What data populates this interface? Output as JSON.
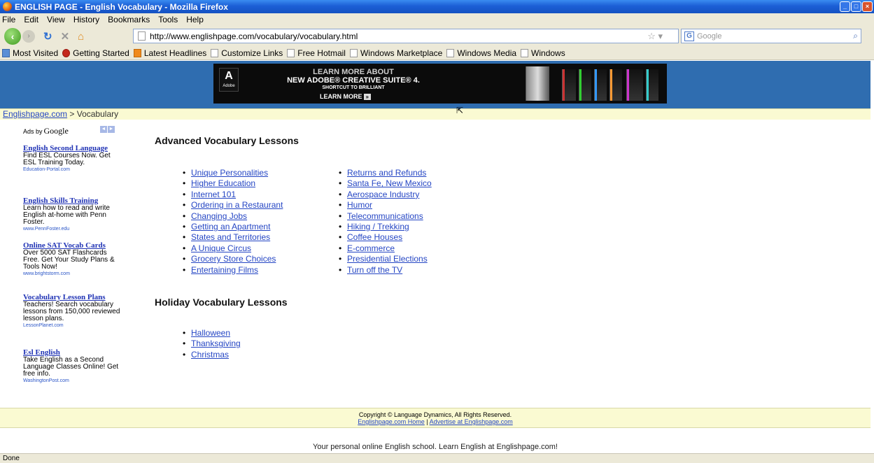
{
  "window": {
    "title": "ENGLISH PAGE - English Vocabulary - Mozilla Firefox"
  },
  "menu": [
    "File",
    "Edit",
    "View",
    "History",
    "Bookmarks",
    "Tools",
    "Help"
  ],
  "nav": {
    "url": "http://www.englishpage.com/vocabulary/vocabulary.html",
    "search_placeholder": "Google"
  },
  "bookmarks": [
    "Most Visited",
    "Getting Started",
    "Latest Headlines",
    "Customize Links",
    "Free Hotmail",
    "Windows Marketplace",
    "Windows Media",
    "Windows"
  ],
  "banner_ad": {
    "line1": "LEARN MORE ABOUT",
    "line2": "NEW ADOBE® CREATIVE SUITE® 4.",
    "line3": "SHORTCUT TO BRILLIANT",
    "button": "LEARN MORE",
    "logo_text": "Adobe"
  },
  "breadcrumb": {
    "home": "Englishpage.com",
    "current": " > Vocabulary"
  },
  "sidebar": {
    "ads_by": "Ads by",
    "google": "Google",
    "ads": [
      {
        "title": "English Second Language",
        "text": "Find ESL Courses Now. Get ESL Training Today.",
        "url": "Education-Portal.com"
      },
      {
        "title": "English Skills Training",
        "text": "Learn how to read and write English at-home with Penn Foster.",
        "url": "www.PennFoster.edu"
      },
      {
        "title": "Online SAT Vocab Cards",
        "text": "Over 5000 SAT Flashcards Free. Get Your Study Plans & Tools Now!",
        "url": "www.brightstorm.com"
      },
      {
        "title": "Vocabulary Lesson Plans",
        "text": "Teachers! Search vocabulary lessons from 150,000 reviewed lesson plans.",
        "url": "LessonPlanet.com"
      },
      {
        "title": "Esl English",
        "text": "Take English as a Second Language Classes Online! Get free info.",
        "url": "WashingtonPost.com"
      }
    ]
  },
  "advanced": {
    "heading": "Advanced Vocabulary Lessons",
    "col1": [
      "Unique Personalities",
      "Higher Education",
      "Internet 101",
      "Ordering in a Restaurant",
      "Changing Jobs",
      "Getting an Apartment",
      "States and Territories",
      "A Unique Circus",
      "Grocery Store Choices",
      "Entertaining Films"
    ],
    "col2": [
      "Returns and Refunds",
      "Santa Fe, New Mexico",
      "Aerospace Industry",
      "Humor",
      "Telecommunications",
      "Hiking / Trekking",
      "Coffee Houses",
      "E-commerce",
      "Presidential Elections",
      "Turn off the TV"
    ]
  },
  "holiday": {
    "heading": "Holiday Vocabulary Lessons",
    "items": [
      "Halloween",
      "Thanksgiving",
      "Christmas"
    ]
  },
  "footer": {
    "copyright": "Copyright © Language Dynamics, All Rights Reserved.",
    "home_link": "Englishpage.com Home",
    "sep": " | ",
    "advertise_link": "Advertise at Englishpage.com",
    "tagline": "Your personal online English school. Learn English at Englishpage.com!"
  },
  "status": "Done"
}
